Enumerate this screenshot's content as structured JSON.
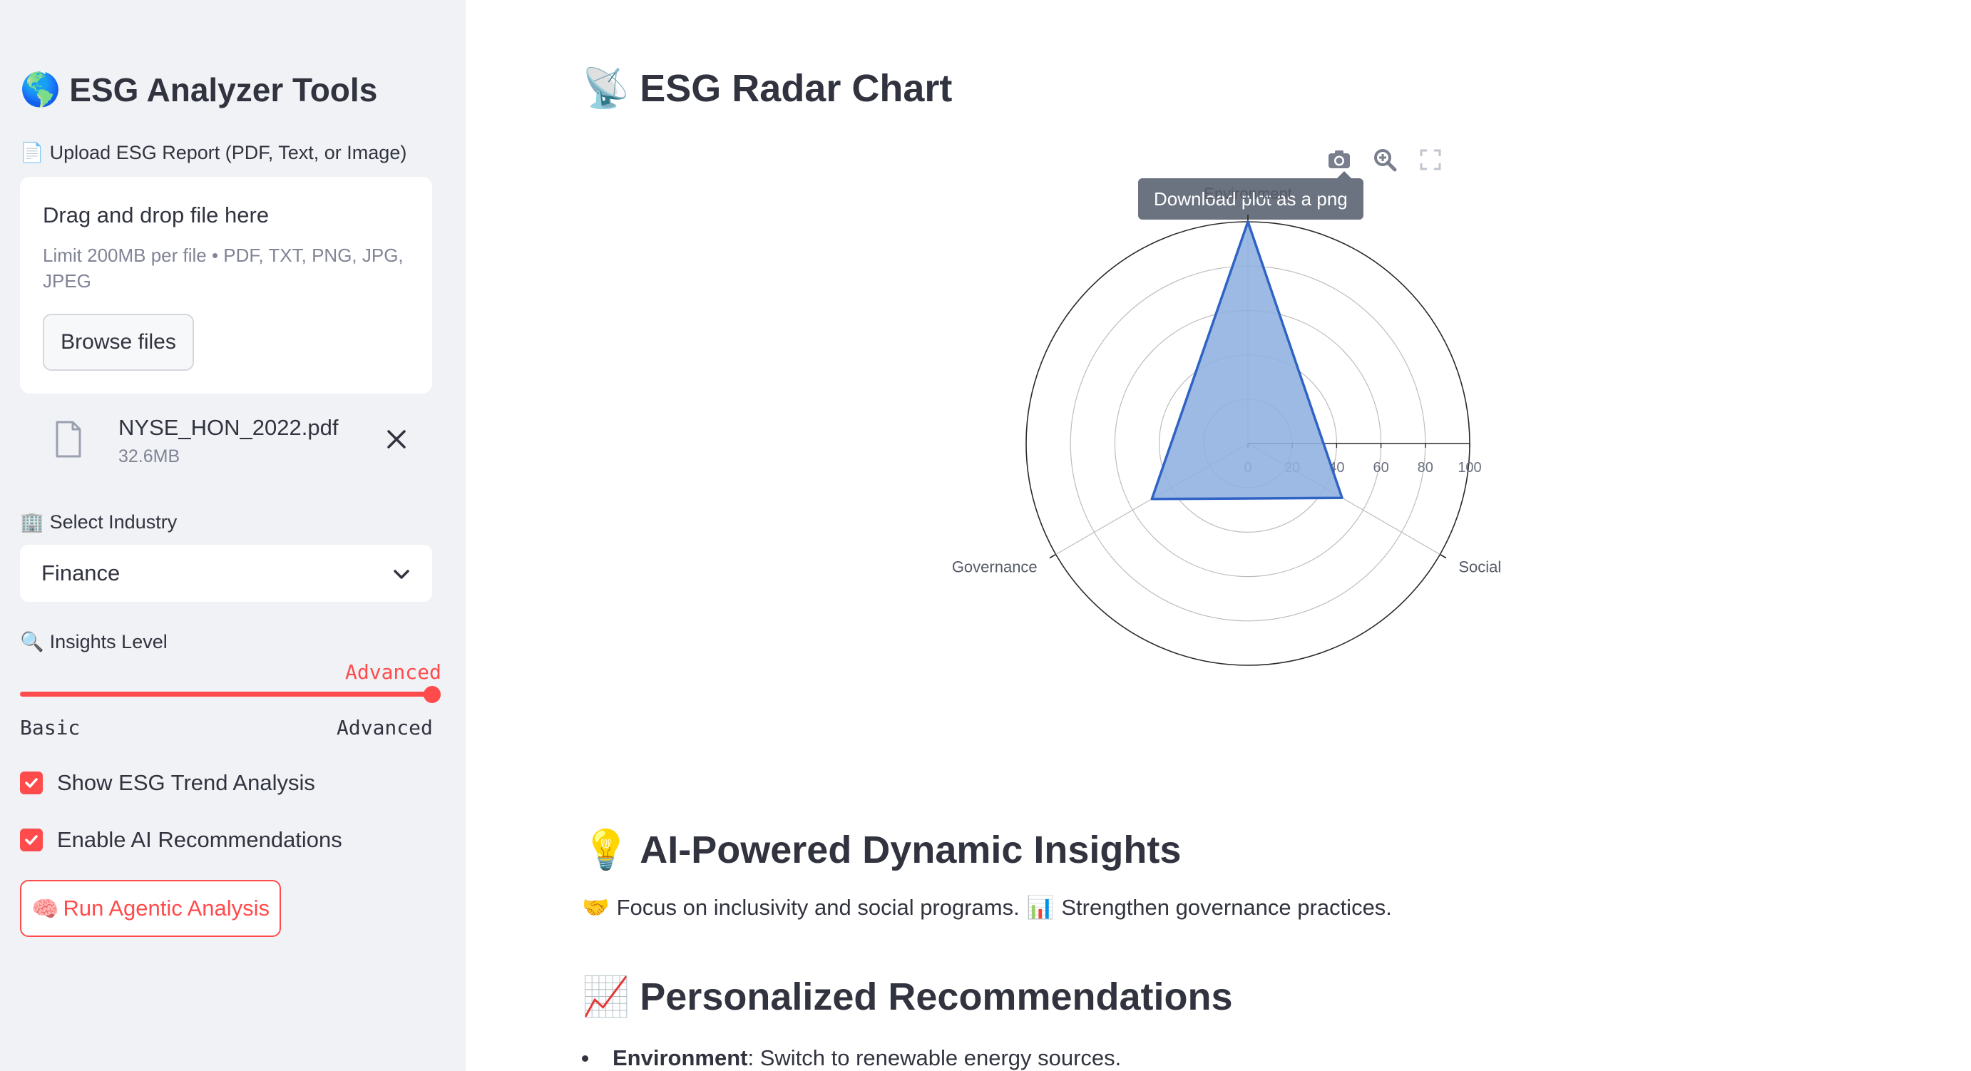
{
  "sidebar": {
    "title_emoji": "🌎",
    "title": "ESG Analyzer Tools",
    "upload": {
      "label_emoji": "📄",
      "label": "Upload ESG Report (PDF, Text, or Image)",
      "drag_text": "Drag and drop file here",
      "limit_text": "Limit 200MB per file • PDF, TXT, PNG, JPG, JPEG",
      "browse_label": "Browse files",
      "file_name": "NYSE_HON_2022.pdf",
      "file_size": "32.6MB"
    },
    "industry": {
      "label_emoji": "🏢",
      "label": "Select Industry",
      "value": "Finance"
    },
    "insights": {
      "label_emoji": "🔍",
      "label": "Insights Level",
      "value": "Advanced",
      "min_label": "Basic",
      "max_label": "Advanced",
      "position": 1.0
    },
    "checks": [
      {
        "label": "Show ESG Trend Analysis",
        "checked": true
      },
      {
        "label": "Enable AI Recommendations",
        "checked": true
      }
    ],
    "run_button": {
      "emoji": "🧠",
      "label": "Run Agentic Analysis"
    }
  },
  "main": {
    "radar_heading_emoji": "📡",
    "radar_heading": "ESG Radar Chart",
    "tooltip": "Download plot as a png",
    "insights_heading_emoji": "💡",
    "insights_heading": "AI-Powered Dynamic Insights",
    "insights_emoji_1": "🤝",
    "insights_text_1": "Focus on inclusivity and social programs.",
    "insights_emoji_2": "📊",
    "insights_text_2": "Strengthen governance practices.",
    "recs_heading_emoji": "📈",
    "recs_heading": "Personalized Recommendations",
    "recs": [
      {
        "bold": "Environment",
        "text": ": Switch to renewable energy sources."
      }
    ]
  },
  "colors": {
    "accent": "#ff4b4b",
    "sidebar_bg": "#f0f2f6",
    "radar_fill": "#8fb0e0",
    "radar_line": "#2f63c4"
  },
  "chart_data": {
    "type": "radar",
    "categories": [
      "Environment",
      "Social",
      "Governance"
    ],
    "values": [
      100,
      49,
      50
    ],
    "radial_ticks": [
      0,
      20,
      40,
      60,
      80,
      100
    ],
    "rlim": [
      0,
      100
    ]
  }
}
